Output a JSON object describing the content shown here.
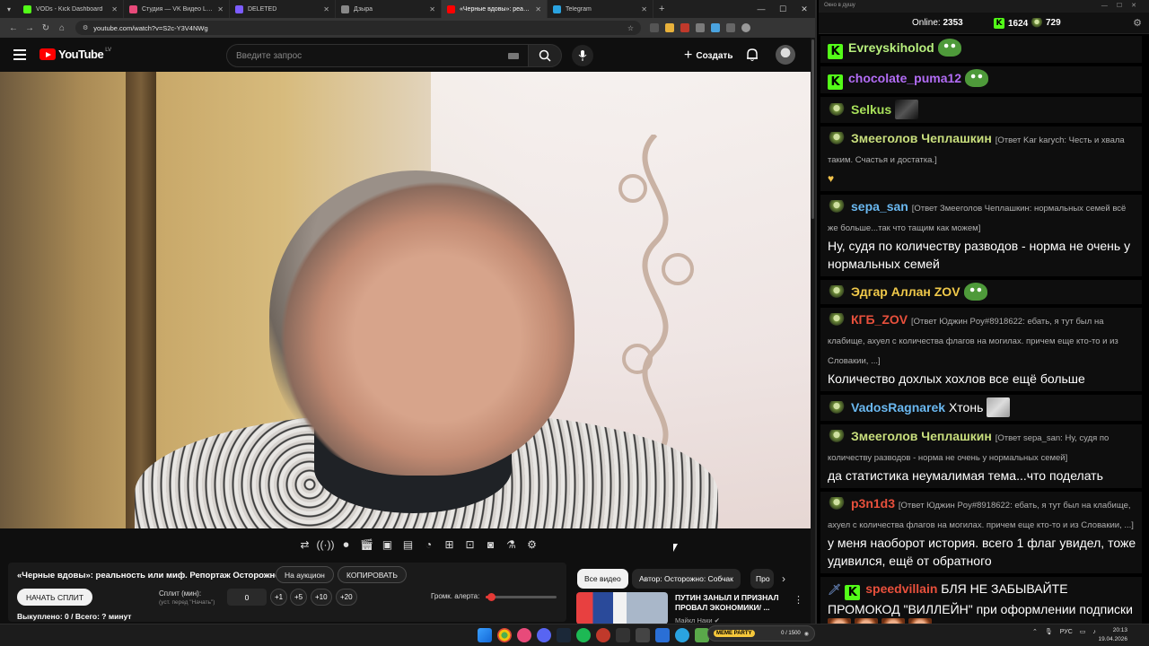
{
  "browser": {
    "tabs": [
      {
        "label": "VODs - Kick Dashboard",
        "color": "#53fc18"
      },
      {
        "label": "Студия — VK Видео Live",
        "color": "#e84a7a"
      },
      {
        "label": "DELETED",
        "color": "#7c5cff"
      },
      {
        "label": "Дзыра",
        "color": "#888888"
      },
      {
        "label": "«Черные вдовы»: реальность",
        "color": "#ff0000",
        "active": true
      },
      {
        "label": "Telegram",
        "color": "#2aa3e0"
      }
    ],
    "url": "youtube.com/watch?v=S2c-Y3V4NWg"
  },
  "youtube": {
    "logo_text": "YouTube",
    "region": "LV",
    "search_placeholder": "Введите запрос",
    "create_label": "Создать"
  },
  "panel": {
    "title": "«Черные вдовы»: реальность или миф. Репортаж Осторожно Media",
    "auction_btn": "На аукцион",
    "copy_btn": "КОПИРОВАТЬ",
    "start_split_btn": "НАЧАТЬ СПЛИТ",
    "split_label": "Сплит (мин):",
    "split_hint": "(уст. перед \"Начать\")",
    "split_value": "0",
    "increments": [
      "+1",
      "+5",
      "+10",
      "+20"
    ],
    "volume_label": "Громк. алерта:",
    "volume_level": 0.07,
    "bought": "Выкуплено: 0 / Всего: ? минут"
  },
  "related": {
    "chips": [
      "Все видео",
      "Автор: Осторожно: Собчак",
      "Про"
    ],
    "video_title": "ПУТИН ЗАНЫЛ И ПРИЗНАЛ ПРОВАЛ ЭКОНОМИКИ/ ...",
    "channel": "Майкл Наки"
  },
  "chat": {
    "window_title": "Окно в душу",
    "online_label": "Online:",
    "online_count": "2353",
    "kick_count": "1624",
    "other_count": "729",
    "messages": [
      {
        "user": "Evreyskiholod",
        "color": "#b7ef7d",
        "badge": "kick",
        "emote": "pepe"
      },
      {
        "user": "chocolate_puma12",
        "color": "#b26cf5",
        "badge": "kick",
        "emote": "pepe"
      },
      {
        "user": "Selkus",
        "color": "#a8e05a",
        "badge": "frog",
        "emote": "dark"
      },
      {
        "user": "Змееголов Чеплашкин",
        "color": "#c9df7d",
        "badge": "frog",
        "reply": "[Ответ Kar karych: Честь и хвала таким. Счастья и достатка.]",
        "heart": true
      },
      {
        "user": "sepa_san",
        "color": "#6ab8f0",
        "badge": "frog",
        "reply": "[Ответ Змееголов Чеплашкин: нормальных семей всё же больше...так что тащим как можем]",
        "text": "Ну, судя по количеству разводов - норма не очень у нормальных семей"
      },
      {
        "user": "Эдгар Аллан ZOV",
        "color": "#f0c94a",
        "badge": "frog",
        "emote": "pepe"
      },
      {
        "user": "КГБ_ZOV",
        "color": "#e8503c",
        "badge": "frog",
        "reply": "[Ответ Юджин Poy#8918622: ебать, я тут был на клабище, ахуел с количества флагов на могилах. причем еще кто-то и из Словакии, ...]",
        "text": "Количество дохлых хохлов все ещё больше"
      },
      {
        "user": "VadosRagnarek",
        "color": "#6ab8f0",
        "badge": "frog",
        "text": "Хтонь",
        "emote": "grey"
      },
      {
        "user": "Змееголов Чеплашкин",
        "color": "#c9df7d",
        "badge": "frog",
        "reply": "[Ответ sepa_san: Ну, судя по количеству разводов - норма не очень у нормальных семей]",
        "text": "да статистика неумалимая тема...что поделать"
      },
      {
        "user": "p3n1d3",
        "color": "#e8503c",
        "badge": "frog",
        "reply": "[Ответ Юджин Poy#8918622: ебать, я тут был на клабище, ахуел с количества флагов на могилах. причем еще кто-то и из Словакии, ...]",
        "text": "у меня наоборот история. всего 1 флаг увидел, тоже удивился, ещё от обратного"
      },
      {
        "user": "speedvillain",
        "color": "#e8503c",
        "badge": "kick",
        "text": "БЛЯ НЕ ЗАБЫВАЙТЕ ПРОМОКОД \"ВИЛЛЕЙН\" при оформлении подписки"
      }
    ]
  },
  "taskbar": {
    "meme_label": "MEME PARTY",
    "meme_count": "0 / 1500",
    "lang": "РУС",
    "time": "20:13",
    "date": "19.04.2026"
  }
}
